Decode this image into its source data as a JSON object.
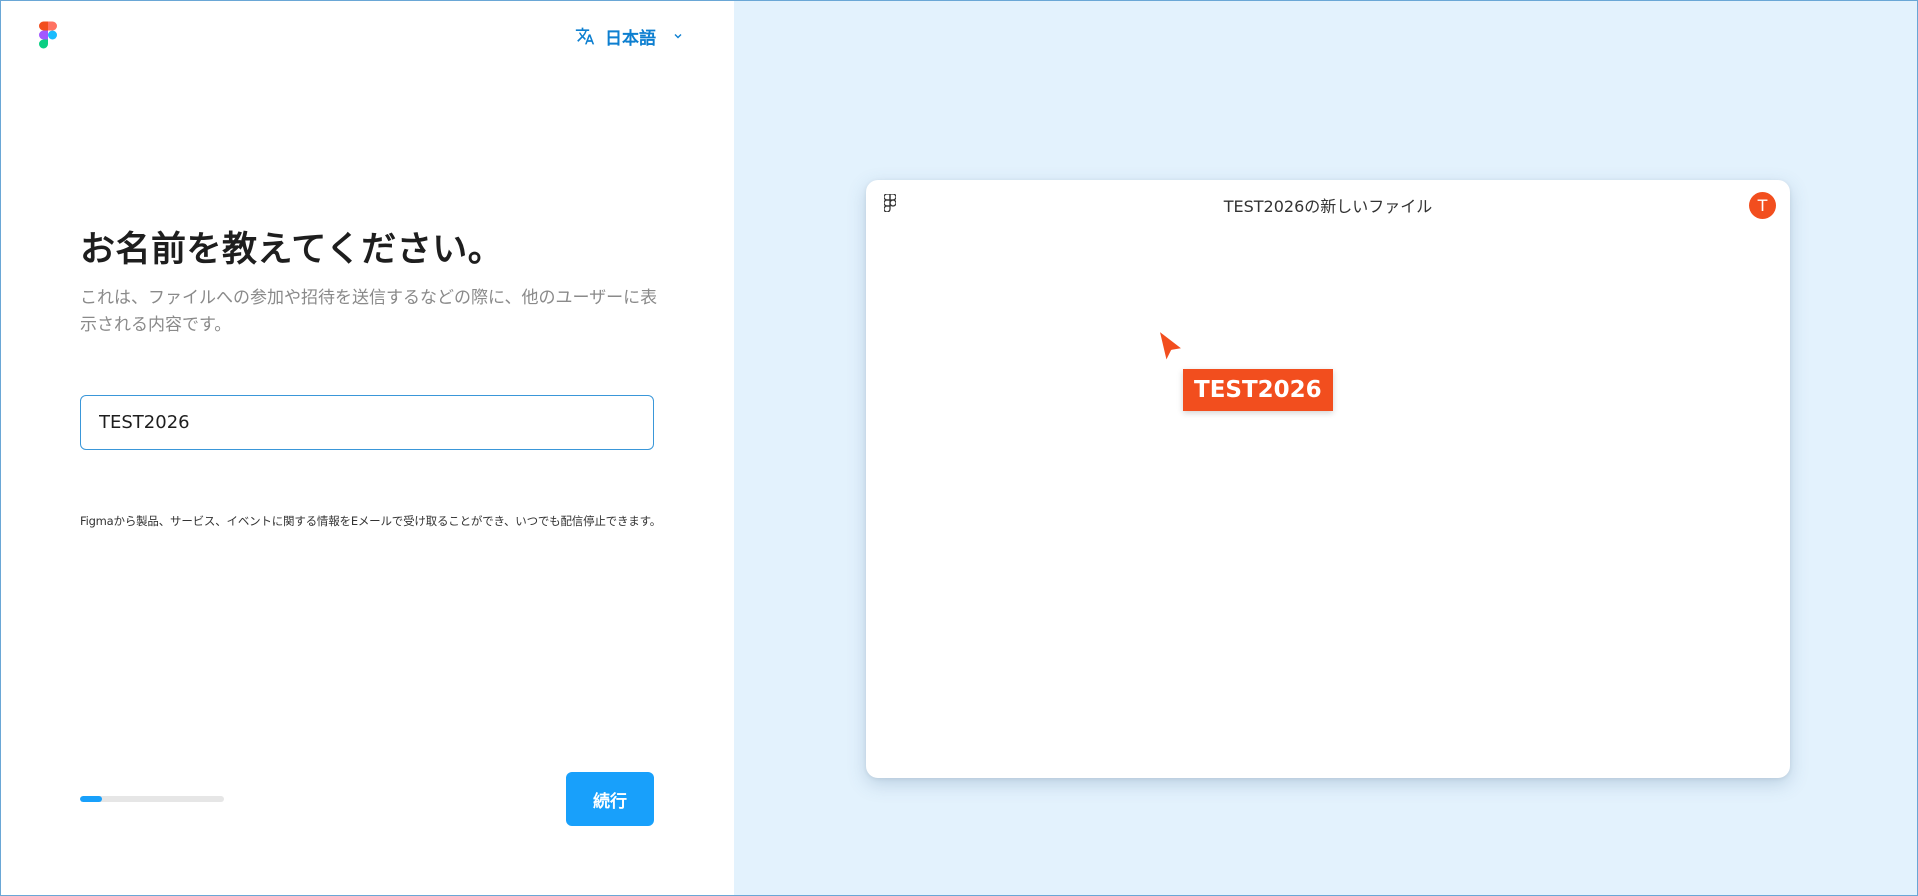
{
  "language": {
    "label": "日本語",
    "icon": "translate-icon"
  },
  "onboarding": {
    "title": "お名前を教えてください。",
    "subtitle": "これは、ファイルへの参加や招待を送信するなどの際に、他のユーザーに表示される内容です。",
    "name_value": "TEST2026",
    "legal": "Figmaから製品、サービス、イベントに関する情報をEメールで受け取ることができ、いつでも配信停止できます。",
    "progress_percent": 15,
    "continue_label": "続行"
  },
  "preview": {
    "file_title": "TEST2026の新しいファイル",
    "avatar_initial": "T",
    "cursor_name": "TEST2026"
  },
  "colors": {
    "accent_blue": "#18a0fb",
    "link_blue": "#0d7fd0",
    "cursor_orange": "#f24e1e",
    "right_panel_bg": "#e3f2fd"
  }
}
